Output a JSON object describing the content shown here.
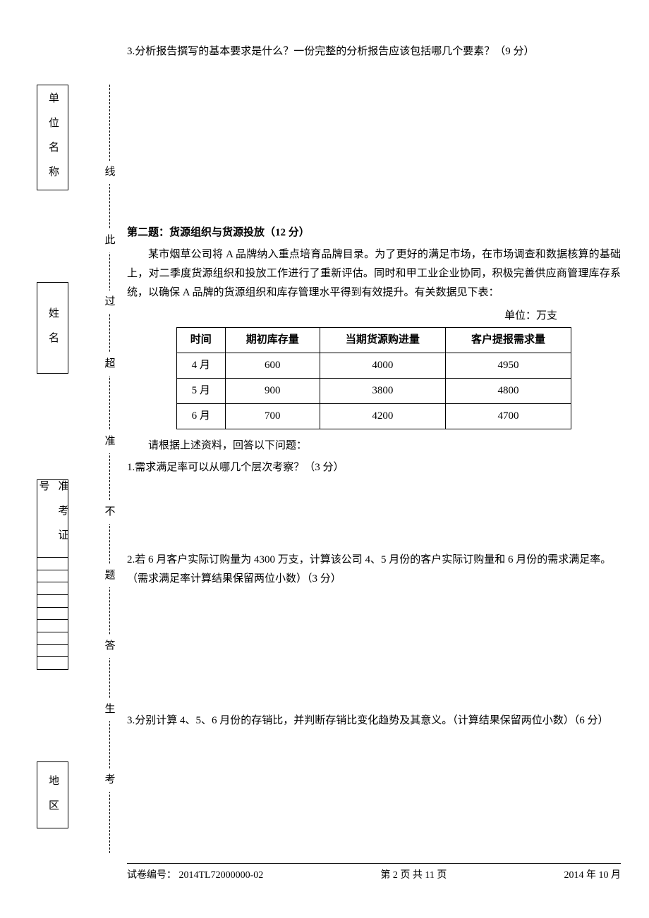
{
  "q1_3": "3.分析报告撰写的基本要求是什么？一份完整的分析报告应该包括哪几个要素？（9 分）",
  "section2": {
    "title": "第二题：货源组织与货源投放（12 分）",
    "para": "某市烟草公司将 A 品牌纳入重点培育品牌目录。为了更好的满足市场，在市场调查和数据核算的基础上，对二季度货源组织和投放工作进行了重新评估。同时和甲工业企业协同，积极完善供应商管理库存系统，以确保 A 品牌的货源组织和库存管理水平得到有效提升。有关数据见下表：",
    "unit": "单位：万支",
    "table": {
      "headers": [
        "时间",
        "期初库存量",
        "当期货源购进量",
        "客户提报需求量"
      ],
      "rows": [
        [
          "4 月",
          "600",
          "4000",
          "4950"
        ],
        [
          "5 月",
          "900",
          "3800",
          "4800"
        ],
        [
          "6 月",
          "700",
          "4200",
          "4700"
        ]
      ]
    },
    "prompt": "请根据上述资料，回答以下问题：",
    "sub1": "1.需求满足率可以从哪几个层次考察？（3 分）",
    "sub2": "2.若 6 月客户实际订购量为 4300 万支，计算该公司 4、5 月份的客户实际订购量和 6 月份的需求满足率。（需求满足率计算结果保留两位小数）（3 分）",
    "sub3": "3.分别计算 4、5、6 月份的存销比，并判断存销比变化趋势及其意义。（计算结果保留两位小数）（6 分）"
  },
  "footer": {
    "left_label": "试卷编号：",
    "left_value": "2014TL72000000-02",
    "center": "第 2 页 共 11 页",
    "right": "2014 年 10 月"
  },
  "binding": {
    "f1": "单 位 名 称",
    "f2": "姓   名",
    "f3": "准 考 证 号",
    "f4": "地   区"
  },
  "cut": {
    "c1": "线",
    "c2": "此",
    "c3": "过",
    "c4": "超",
    "c5": "准",
    "c6": "不",
    "c7": "题",
    "c8": "答",
    "c9": "生",
    "c10": "考"
  },
  "chart_data": {
    "type": "table",
    "title": "货源组织与货源投放数据",
    "unit": "万支",
    "columns": [
      "时间",
      "期初库存量",
      "当期货源购进量",
      "客户提报需求量"
    ],
    "rows": [
      {
        "时间": "4 月",
        "期初库存量": 600,
        "当期货源购进量": 4000,
        "客户提报需求量": 4950
      },
      {
        "时间": "5 月",
        "期初库存量": 900,
        "当期货源购进量": 3800,
        "客户提报需求量": 4800
      },
      {
        "时间": "6 月",
        "期初库存量": 700,
        "当期货源购进量": 4200,
        "客户提报需求量": 4700
      }
    ]
  }
}
